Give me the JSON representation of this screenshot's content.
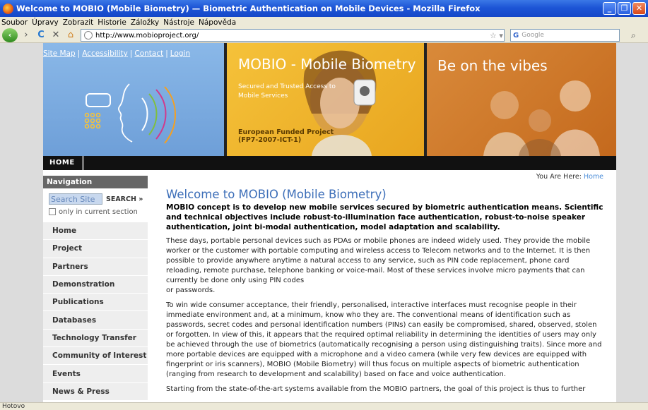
{
  "window": {
    "title": "Welcome to MOBIO (Mobile Biometry) — Biometric Authentication on Mobile Devices - Mozilla Firefox",
    "controls": [
      "_",
      "❐",
      "✕"
    ]
  },
  "menu": [
    "Soubor",
    "Úpravy",
    "Zobrazit",
    "Historie",
    "Záložky",
    "Nástroje",
    "Nápověda"
  ],
  "browser": {
    "url": "http://www.mobioproject.org/",
    "search_placeholder": "Google",
    "status": "Hotovo"
  },
  "colors": {
    "accent": "#3c6eb8",
    "banner_blue": "#7aaae0",
    "banner_yellow": "#f0b832",
    "banner_orange": "#d07a2a"
  },
  "banner": {
    "links": [
      "Site Map",
      "Accessibility",
      "Contact",
      "Login"
    ],
    "title": "MOBIO - Mobile Biometry",
    "subtitle": "Secured and Trusted Access to Mobile Services",
    "funded_line1": "European Funded Project",
    "funded_line2": "(FP7-2007-ICT-1)",
    "slogan": "Be on the vibes"
  },
  "topnav": {
    "home": "HOME"
  },
  "sidebar": {
    "heading": "Navigation",
    "search_value": "Search Site",
    "search_button": "SEARCH »",
    "only_current": "only in current section",
    "items": [
      "Home",
      "Project",
      "Partners",
      "Demonstration",
      "Publications",
      "Databases",
      "Technology Transfer",
      "Community of Interest",
      "Events",
      "News & Press"
    ]
  },
  "breadcrumb": {
    "label": "You Are Here:",
    "link": "Home"
  },
  "content": {
    "heading": "Welcome to MOBIO (Mobile Biometry)",
    "intro": "MOBIO concept is to develop new mobile services secured by biometric authentication means. Scientific and technical objectives include robust-to-illumination face authentication, robust-to-noise speaker authentication, joint bi-modal authentication, model adaptation and scalability.",
    "p1": "These days, portable personal devices such as PDAs or mobile phones are indeed widely used. They provide the mobile worker or the customer with portable computing and wireless access to Telecom networks and to the Internet. It is then possible to provide anywhere anytime a natural access to any service, such as PIN code replacement, phone card reloading, remote purchase, telephone banking or voice-mail. Most of these services involve micro payments that can currently be done only using PIN codes",
    "p1b": "or passwords.",
    "p2": "To win wide consumer acceptance, their friendly, personalised, interactive interfaces must recognise people in their immediate environment and, at a minimum, know who they are. The conventional means of identification such as passwords, secret codes and personal identification numbers (PINs) can easily be compromised, shared, observed, stolen or forgotten. In view of this, it appears that the required optimal reliability in determining the identities of users may only be achieved through the use of biometrics (automatically recognising a person using distinguishing traits). Since more and more portable devices are equipped with a microphone and a video camera (while very few devices are equipped with fingerprint or iris scanners), MOBIO (Mobile Biometry) will thus focus on multiple aspects of biometric authentication (ranging from research to development and scalability) based on face and voice authentication.",
    "p3": "Starting from the state-of-the-art systems available from the MOBIO partners, the goal of this project is thus to further"
  }
}
